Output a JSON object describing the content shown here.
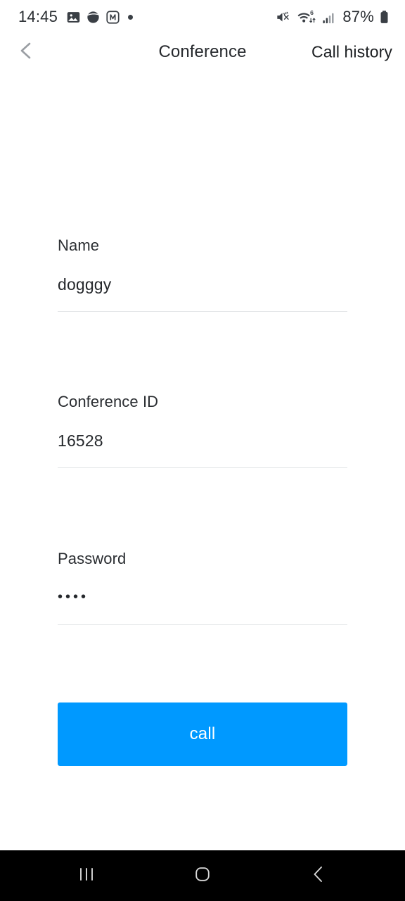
{
  "colors": {
    "accent": "#0099ff",
    "page_bg": "#ffffff",
    "navbar_bg": "#000000",
    "text_primary": "#25282c",
    "text_header": "#26292d",
    "divider": "#e4e6e8",
    "chevron_gray": "#9a9ea3",
    "status_text": "#2b2f33"
  },
  "status_bar": {
    "time": "14:45",
    "notification_icons": [
      {
        "name": "gallery-photo-icon",
        "label": "Gallery"
      },
      {
        "name": "opera-browser-icon",
        "label": "Browser"
      },
      {
        "name": "m-app-icon",
        "label": "M"
      },
      {
        "name": "more-notifications-dot",
        "label": "More"
      }
    ],
    "system_icons": [
      {
        "name": "mute-vibrate-icon",
        "label": "Sound off"
      },
      {
        "name": "wifi-6-icon",
        "label": "Wi-Fi 6",
        "badge": "6"
      },
      {
        "name": "cellular-signal-icon",
        "label": "Signal"
      }
    ],
    "battery_percent": "87%",
    "battery_icon": "battery-full-icon"
  },
  "header": {
    "back_icon": "chevron-left-icon",
    "title": "Conference",
    "action_label": "Call history"
  },
  "form": {
    "fields": [
      {
        "key": "name",
        "label": "Name",
        "value": "dogggy",
        "placeholder": "Name",
        "masked": false,
        "type": "text"
      },
      {
        "key": "conference_id",
        "label": "Conference ID",
        "value": "16528",
        "placeholder": "Conference ID",
        "masked": false,
        "type": "number"
      },
      {
        "key": "password",
        "label": "Password",
        "value": "••••",
        "masked_char_count": 4,
        "placeholder": "Password",
        "masked": true,
        "type": "password"
      }
    ],
    "submit_label": "call"
  },
  "nav_bar": {
    "buttons": [
      {
        "name": "recents-button",
        "icon": "recents-icon",
        "label": "Recents"
      },
      {
        "name": "home-button",
        "icon": "home-icon",
        "label": "Home"
      },
      {
        "name": "back-button",
        "icon": "chevron-left-icon",
        "label": "Back"
      }
    ]
  }
}
